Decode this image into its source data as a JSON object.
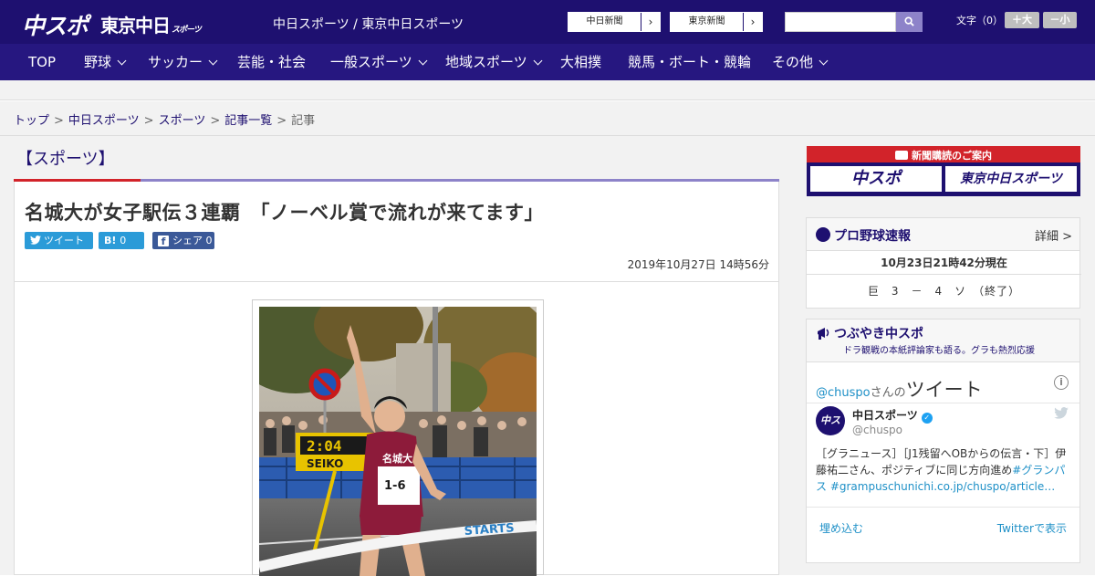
{
  "header": {
    "logo_main": "中スポ",
    "logo_tokyo": "東京中日",
    "logo_tokyo_sub": "スポーツ",
    "site_name": "中日スポーツ / 東京中日スポーツ",
    "paper_links": [
      {
        "label": "中日新聞"
      },
      {
        "label": "東京新聞"
      }
    ],
    "font_size_label": "文字（0）",
    "font_bigger": "＋大",
    "font_smaller": "－小"
  },
  "nav": {
    "items": [
      {
        "label": "TOP",
        "has_menu": false
      },
      {
        "label": "野球",
        "has_menu": true
      },
      {
        "label": "サッカー",
        "has_menu": true
      },
      {
        "label": "芸能・社会",
        "has_menu": false
      },
      {
        "label": "一般スポーツ",
        "has_menu": true
      },
      {
        "label": "地域スポーツ",
        "has_menu": true
      },
      {
        "label": "大相撲",
        "has_menu": false
      },
      {
        "label": "競馬・ボート・競輪",
        "has_menu": false
      },
      {
        "label": "その他",
        "has_menu": true
      }
    ]
  },
  "breadcrumb": {
    "items": [
      "トップ",
      "中日スポーツ",
      "スポーツ",
      "記事一覧"
    ],
    "current": "記事",
    "separator": ">"
  },
  "article": {
    "section": "【スポーツ】",
    "headline": "名城大が女子駅伝３連覇　「ノーベル賞で流れが来てます」",
    "share": {
      "twitter": "ツイート",
      "hatena": "B!",
      "hatena_count": "0",
      "facebook": "シェア",
      "facebook_count": "0"
    },
    "date": "2019年10月27日 14時56分",
    "photo_texts": {
      "clock": "2:04",
      "clock_brand": "SEIKO",
      "bib_team": "名城大",
      "bib_number": "1-6",
      "tape_brand": "STARTS"
    }
  },
  "sidebar": {
    "subscribe": {
      "title": "新聞購読のご案内",
      "option1": "中スポ",
      "option2": "東京中日スポーツ"
    },
    "baseball": {
      "title": "プロ野球速報",
      "more": "詳細 >",
      "timestamp": "10月23日21時42分現在",
      "score": "巨　3　－　4　ソ　（終了）"
    },
    "tweets": {
      "title": "つぶやき中スポ",
      "subtitle": "ドラ観戦の本紙評論家も語る。グラも熱烈応援",
      "handle_link": "@chuspo",
      "handle_suffix": "さんの",
      "header_word": "ツイート",
      "account_name": "中日スポーツ",
      "account_handle": "@chuspo",
      "avatar_text": "中スポ",
      "tweet_text": "［グラニュース］［J1残留へOBからの伝言・下］伊藤祐二さん、ポジティブに同じ方向進め",
      "tweet_link": "#グランパス #grampuschunichi.co.jp/chuspo/article…",
      "embed": "埋め込む",
      "view_on": "Twitterで表示"
    }
  },
  "colors": {
    "brand": "#1e1070",
    "nav": "#261780",
    "accent_red": "#d2232a",
    "twitter_blue": "#2b9bd8",
    "facebook_blue": "#3b5998"
  }
}
